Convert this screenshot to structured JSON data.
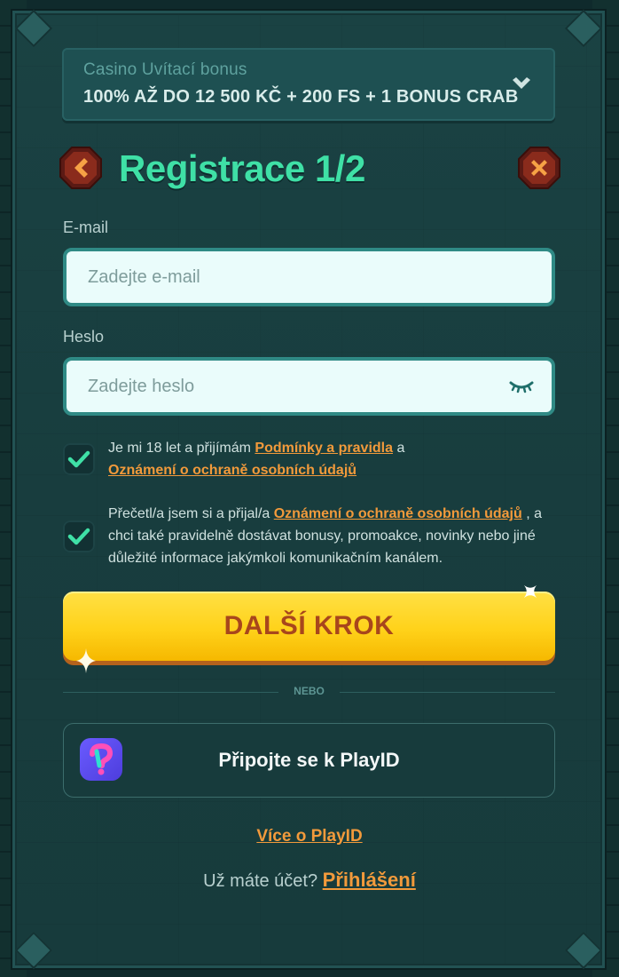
{
  "bonus": {
    "label": "Casino Uvítací bonus",
    "value": "100% AŽ DO 12 500 KČ + 200 FS + 1 BONUS CRAB",
    "icon": "chevron-down-icon"
  },
  "header": {
    "title": "Registrace 1/2",
    "back_icon": "arrow-left-icon",
    "close_icon": "close-icon"
  },
  "form": {
    "email_label": "E-mail",
    "email_placeholder": "Zadejte e-mail",
    "email_value": "",
    "password_label": "Heslo",
    "password_placeholder": "Zadejte heslo",
    "password_value": "",
    "password_toggle_icon": "eye-closed-icon"
  },
  "consents": [
    {
      "checked": true,
      "text_before": "Je mi 18 let a přijímám ",
      "link1": "Podmínky a pravidla",
      "text_middle": " a ",
      "link2": "Oznámení o ochraně osobních údajů"
    },
    {
      "checked": true,
      "text_before": "Přečetl/a jsem si a přijal/a ",
      "link1": "Oznámení o ochraně osobních údajů",
      "text_after": " , a chci také pravidelně dostávat bonusy, promoakce, novinky nebo jiné důležité informace jakýmkoli komunikačním kanálem."
    }
  ],
  "actions": {
    "next_label": "DALŠÍ KROK",
    "divider_text": "NEBO",
    "playid_label": "Připojte se k PlayID",
    "more_playid": "Více o PlayID",
    "have_account": "Už máte účet? ",
    "login_label": "Přihlášení"
  },
  "colors": {
    "accent_green": "#3fe0a6",
    "link_orange": "#f29a3b",
    "button_yellow": "#ffd21a",
    "button_text": "#a8461c",
    "panel_bg": "#1a4243"
  }
}
